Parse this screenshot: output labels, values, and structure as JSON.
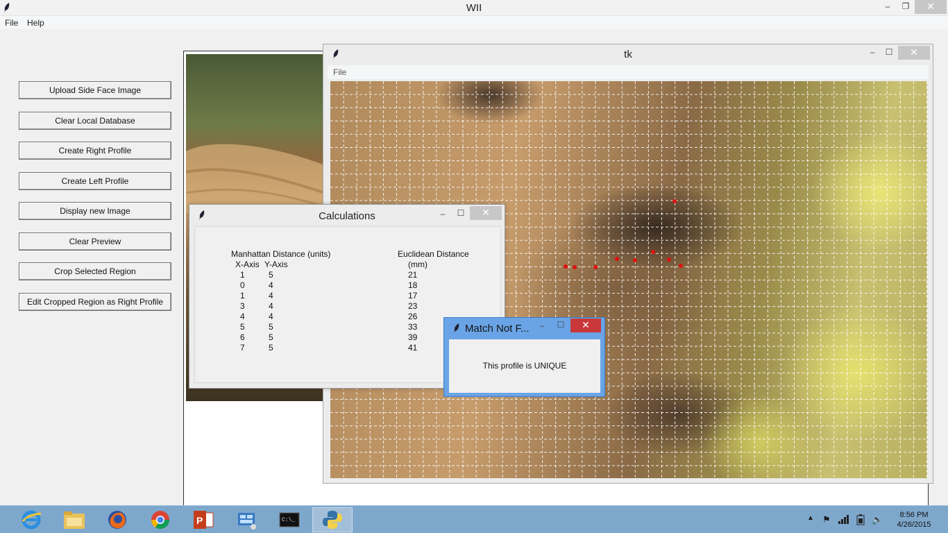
{
  "main_window": {
    "title": "WII",
    "controls": {
      "minimize": "‒",
      "maximize": "❐",
      "close": "✕"
    },
    "menu": [
      "File",
      "Help"
    ],
    "buttons": [
      "Upload Side Face Image",
      "Clear Local Database",
      "Create Right Profile",
      "Create Left Profile",
      "Display new Image",
      "Clear Preview",
      "Crop Selected Region",
      "Edit Cropped Region as Right Profile"
    ]
  },
  "tk_window": {
    "title": "tk",
    "menu": [
      "File"
    ],
    "controls": {
      "minimize": "‒",
      "maximize": "☐",
      "close": "✕"
    },
    "marker_color": "#e01010"
  },
  "calculations_dialog": {
    "title": "Calculations",
    "controls": {
      "minimize": "‒",
      "maximize": "☐",
      "close": "✕"
    },
    "manhattan_header": "Manhattan Distance (units)",
    "x_header": "X-Axis",
    "y_header": "Y-Axis",
    "euclidean_header": "Euclidean Distance",
    "euclidean_unit": "(mm)",
    "rows": [
      {
        "x": "1",
        "y": "5",
        "e": "21"
      },
      {
        "x": "0",
        "y": "4",
        "e": "18"
      },
      {
        "x": "1",
        "y": "4",
        "e": "17"
      },
      {
        "x": "3",
        "y": "4",
        "e": "23"
      },
      {
        "x": "4",
        "y": "4",
        "e": "26"
      },
      {
        "x": "5",
        "y": "5",
        "e": "33"
      },
      {
        "x": "6",
        "y": "5",
        "e": "39"
      },
      {
        "x": "7",
        "y": "5",
        "e": "41"
      }
    ]
  },
  "match_dialog": {
    "title": "Match Not F...",
    "message": "This profile is UNIQUE",
    "controls": {
      "minimize": "‒",
      "maximize": "☐",
      "close": "✕"
    }
  },
  "taskbar": {
    "apps": [
      "internet-explorer",
      "file-explorer",
      "firefox",
      "chrome",
      "powerpoint",
      "control-panel",
      "command-prompt",
      "python"
    ],
    "active_app": "python",
    "time": "8:56 PM",
    "date": "4/26/2015",
    "accent_color": "#7ea7cc"
  }
}
